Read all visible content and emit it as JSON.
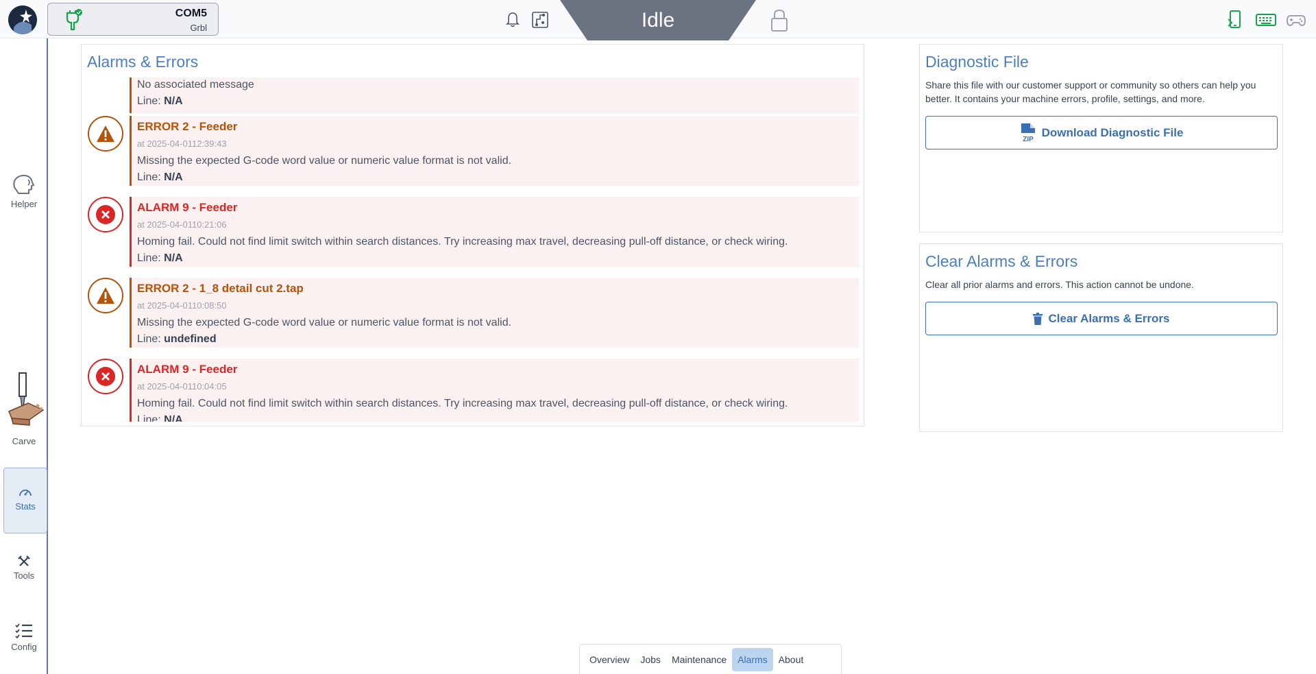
{
  "topbar": {
    "port": "COM5",
    "firmware": "Grbl",
    "state": "Idle"
  },
  "sidebar": {
    "items": [
      {
        "label": "Helper"
      },
      {
        "label": "Carve"
      },
      {
        "label": "Stats"
      },
      {
        "label": "Tools"
      },
      {
        "label": "Config"
      }
    ]
  },
  "alarms_panel": {
    "title": "Alarms & Errors",
    "partial": {
      "message": "No associated message",
      "line_label": "Line:",
      "line_value": "N/A"
    },
    "entries": [
      {
        "type": "error",
        "title": "ERROR 2 - Feeder",
        "time": "at 2025-04-0112:39:43",
        "message": "Missing the expected G-code word value or numeric value format is not valid.",
        "line_label": "Line:",
        "line_value": "N/A"
      },
      {
        "type": "alarm",
        "title": "ALARM 9 - Feeder",
        "time": "at 2025-04-0110:21:06",
        "message": "Homing fail. Could not find limit switch within search distances. Try increasing max travel, decreasing pull-off distance, or check wiring.",
        "line_label": "Line:",
        "line_value": "N/A"
      },
      {
        "type": "error",
        "title": "ERROR 2 - 1_8 detail cut 2.tap",
        "time": "at 2025-04-0110:08:50",
        "message": "Missing the expected G-code word value or numeric value format is not valid.",
        "line_label": "Line:",
        "line_value": "undefined"
      },
      {
        "type": "alarm",
        "title": "ALARM 9 - Feeder",
        "time": "at 2025-04-0110:04:05",
        "message": "Homing fail. Could not find limit switch within search distances. Try increasing max travel, decreasing pull-off distance, or check wiring.",
        "line_label": "Line:",
        "line_value": "N/A"
      }
    ]
  },
  "diagnostic": {
    "title": "Diagnostic File",
    "description_1": "Share this file with our customer support or community so others can help you",
    "description_2": "better. It contains your machine errors, profile, settings, and more.",
    "button_label": "Download Diagnostic File",
    "zip_text": "ZIP"
  },
  "clear": {
    "title": "Clear Alarms & Errors",
    "description": "Clear all prior alarms and errors. This action cannot be undone.",
    "button_label": "Clear Alarms & Errors"
  },
  "tabs": [
    {
      "label": "Overview"
    },
    {
      "label": "Jobs"
    },
    {
      "label": "Maintenance"
    },
    {
      "label": "Alarms"
    },
    {
      "label": "About"
    }
  ],
  "colors": {
    "accent": "#4a7ec2",
    "error": "#b45309",
    "alarm": "#dc2626",
    "status_green": "#16a34a"
  }
}
